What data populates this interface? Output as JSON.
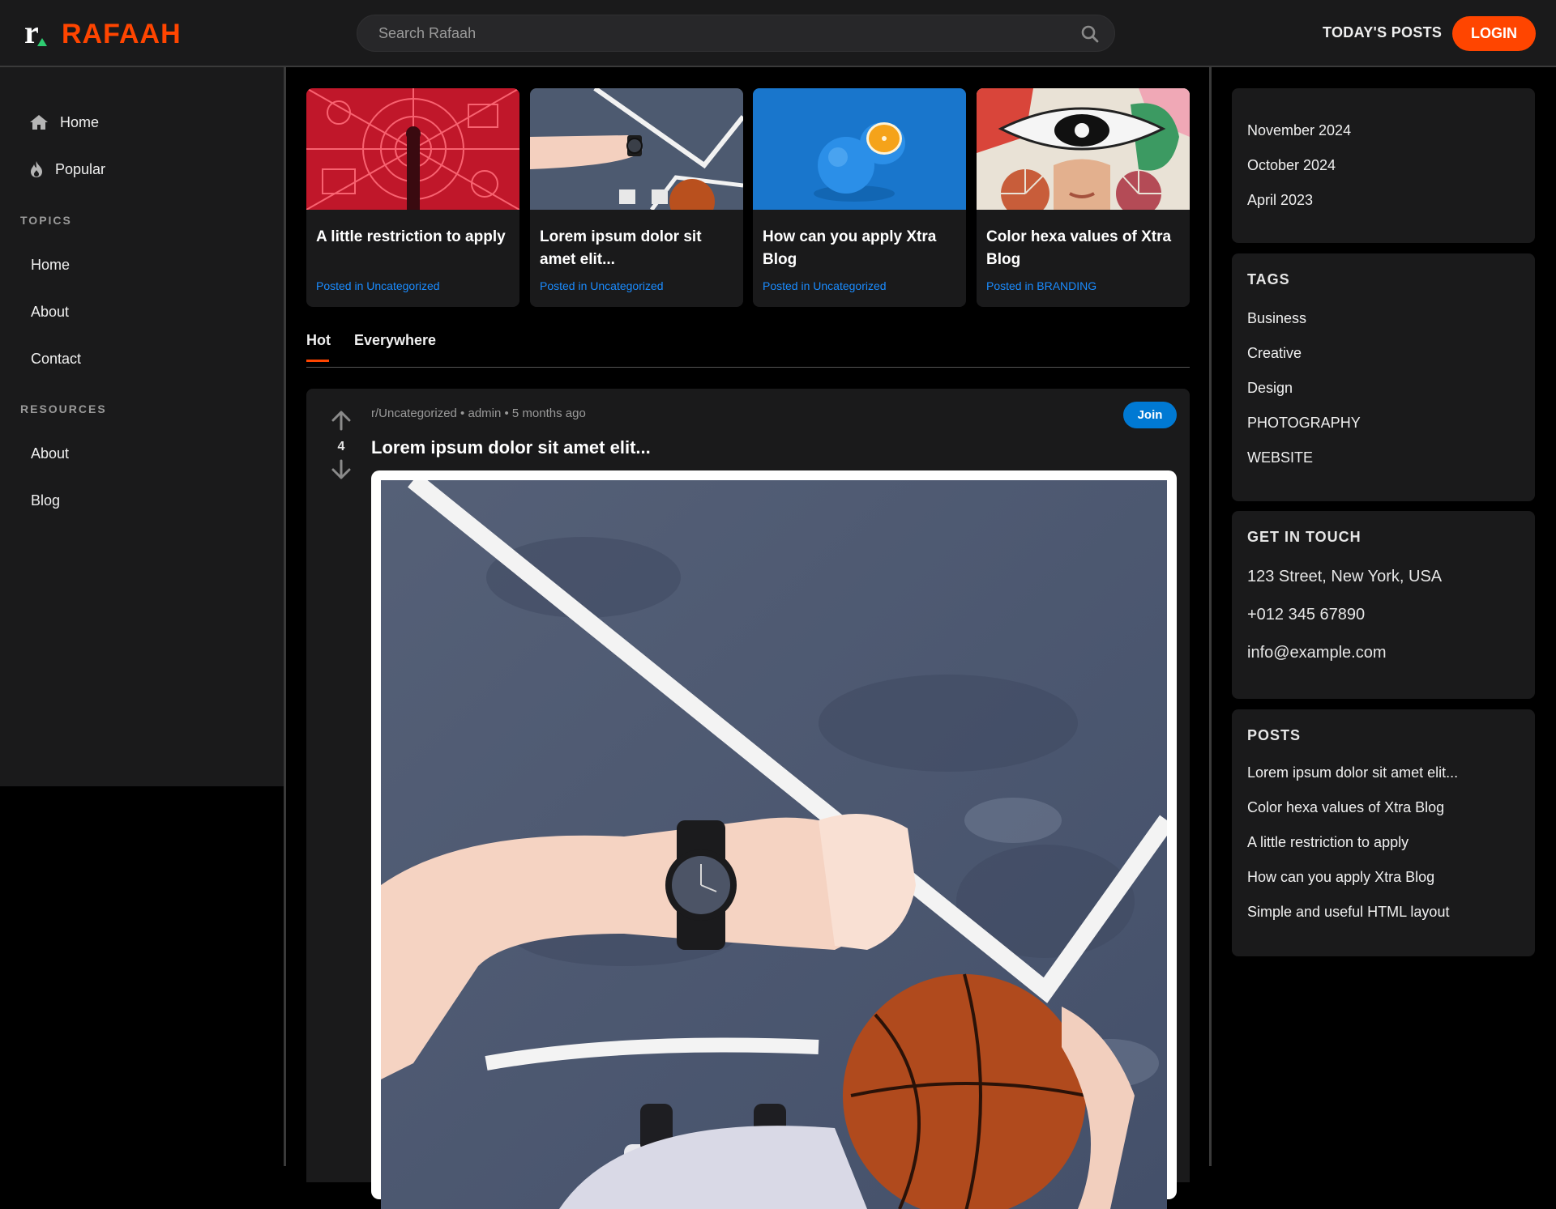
{
  "header": {
    "logo_letter": "r",
    "logo_text": "RAFAAH",
    "search_placeholder": "Search Rafaah",
    "todays_posts": "TODAY'S POSTS",
    "login": "LOGIN"
  },
  "sidebar": {
    "main": [
      {
        "label": "Home",
        "icon": "home-icon"
      },
      {
        "label": "Popular",
        "icon": "flame-icon"
      }
    ],
    "topics_heading": "TOPICS",
    "topics": [
      "Home",
      "About",
      "Contact"
    ],
    "resources_heading": "RESOURCES",
    "resources": [
      "About",
      "Blog"
    ]
  },
  "featured": [
    {
      "title": "A little restriction to apply",
      "meta": "Posted in Uncategorized"
    },
    {
      "title": "Lorem ipsum dolor sit amet elit...",
      "meta": "Posted in Uncategorized"
    },
    {
      "title": "How can you apply Xtra Blog",
      "meta": "Posted in Uncategorized"
    },
    {
      "title": "Color hexa values of Xtra Blog",
      "meta": "Posted in BRANDING"
    }
  ],
  "tabs": [
    "Hot",
    "Everywhere"
  ],
  "post": {
    "votes": "4",
    "meta": "r/Uncategorized • admin • 5 months ago",
    "join": "Join",
    "title": "Lorem ipsum dolor sit amet elit..."
  },
  "archives": [
    "November 2024",
    "October 2024",
    "April 2023"
  ],
  "tags": {
    "title": "TAGS",
    "items": [
      "Business",
      "Creative",
      "Design",
      "PHOTOGRAPHY",
      "WEBSITE"
    ]
  },
  "contact": {
    "title": "GET IN TOUCH",
    "address": "123 Street, New York, USA",
    "phone": "+012 345 67890",
    "email": "info@example.com"
  },
  "posts": {
    "title": "POSTS",
    "items": [
      "Lorem ipsum dolor sit amet elit...",
      "Color hexa values of Xtra Blog",
      "A little restriction to apply",
      "How can you apply Xtra Blog",
      "Simple and useful HTML layout"
    ]
  },
  "colors": {
    "brand": "#ff4500",
    "link": "#1a8cff",
    "join": "#0079d3",
    "panel": "#1a1a1b"
  }
}
